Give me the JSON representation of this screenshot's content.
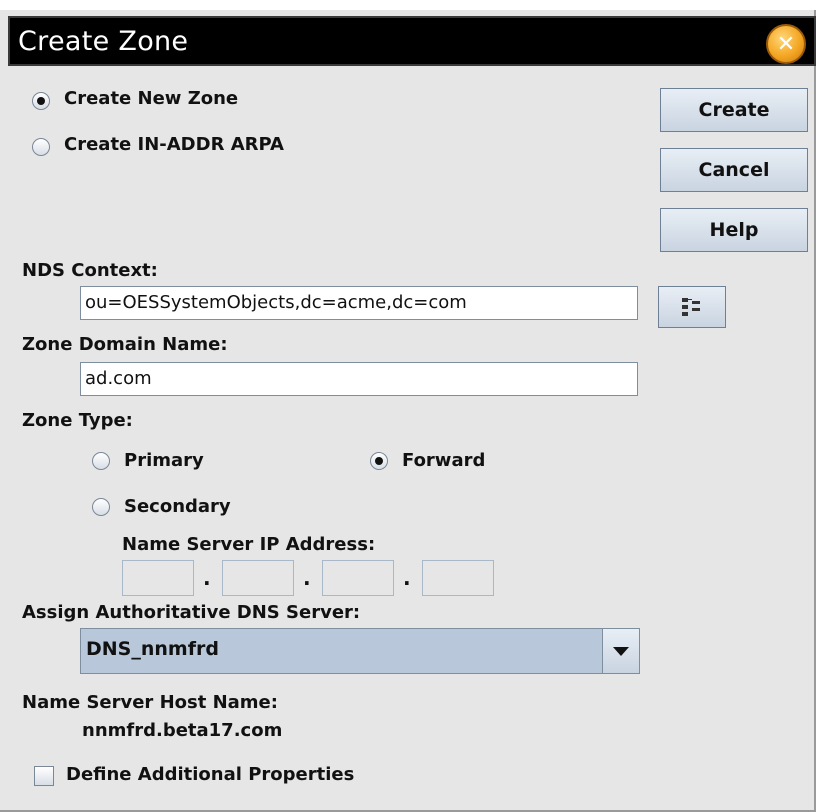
{
  "window": {
    "title": "Create Zone"
  },
  "zone_mode": {
    "options": [
      "Create New Zone",
      "Create IN-ADDR ARPA"
    ],
    "selected": "Create New Zone"
  },
  "buttons": {
    "create": "Create",
    "cancel": "Cancel",
    "help": "Help"
  },
  "nds_context": {
    "label": "NDS Context:",
    "value": "ou=OESSystemObjects,dc=acme,dc=com",
    "browse_icon": "tree-browse-icon"
  },
  "zone_domain": {
    "label": "Zone Domain Name:",
    "value": "ad.com"
  },
  "zone_type": {
    "label": "Zone Type:",
    "primary": "Primary",
    "secondary": "Secondary",
    "forward": "Forward",
    "selected": "Forward"
  },
  "name_server_ip": {
    "label": "Name Server IP Address:",
    "octets": [
      "",
      "",
      "",
      ""
    ],
    "separator": "."
  },
  "authoritative_dns": {
    "label": "Assign Authoritative DNS Server:",
    "selected": "DNS_nnmfrd"
  },
  "name_server_host": {
    "label": "Name Server Host Name:",
    "value": "nnmfrd.beta17.com"
  },
  "additional_properties": {
    "label": "Define Additional Properties",
    "checked": false
  },
  "colors": {
    "title_bar": "#000000",
    "dialog_bg": "#e6e6e6",
    "close_button": "#f4a623",
    "button_gradient_top": "#e8eef5",
    "dropdown_bg": "#b8c8da"
  }
}
